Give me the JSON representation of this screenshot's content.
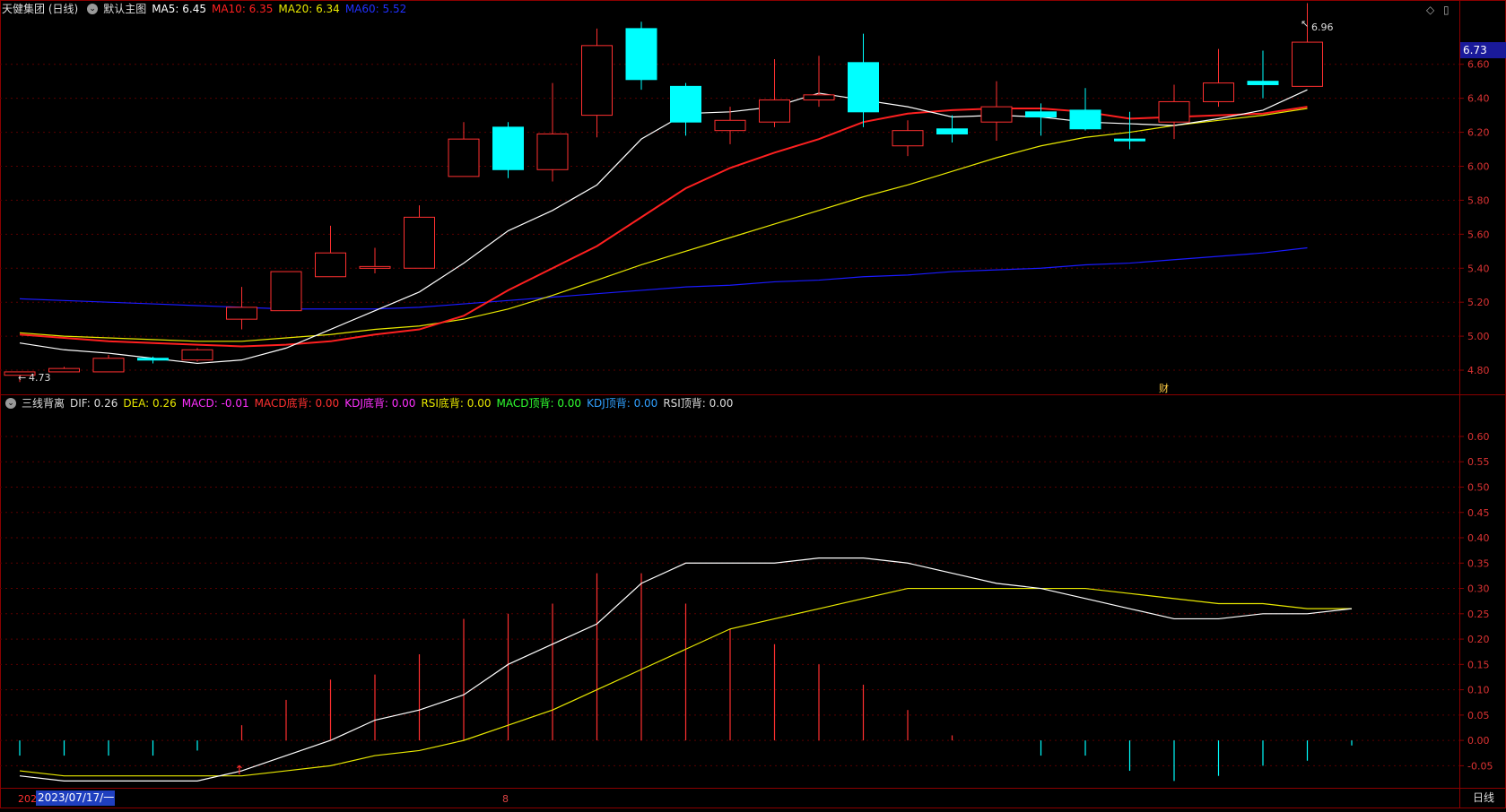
{
  "main_header": {
    "stock_name": "天健集团 (日线)",
    "template": "默认主图",
    "ma5": {
      "label": "MA5: 6.45",
      "color": "#ffffff"
    },
    "ma10": {
      "label": "MA10: 6.35",
      "color": "#ff2020"
    },
    "ma20": {
      "label": "MA20: 6.34",
      "color": "#e8e800"
    },
    "ma60": {
      "label": "MA60: 5.52",
      "color": "#2030ff"
    }
  },
  "sub_header": {
    "indicator": "三线背离",
    "dif": "DIF: 0.26",
    "dea": "DEA: 0.26",
    "macd": "MACD: -0.01",
    "macd_bottom": "MACD底背: 0.00",
    "kdj_bottom": "KDJ底背: 0.00",
    "rsi_bottom": "RSI底背: 0.00",
    "macd_top": "MACD顶背: 0.00",
    "kdj_top": "KDJ顶背: 0.00",
    "rsi_top": "RSI顶背: 0.00"
  },
  "annotations": {
    "low_label": "4.73",
    "high_label": "6.96",
    "current_price": "6.73",
    "finance_marker": "财"
  },
  "footer": {
    "year_prefix": "202",
    "date_cursor": "2023/07/17/一",
    "month_marker": "8",
    "period_button": "日线"
  },
  "price_axis": [
    "6.60",
    "6.40",
    "6.20",
    "6.00",
    "5.80",
    "5.60",
    "5.40",
    "5.20",
    "5.00",
    "4.80"
  ],
  "macd_axis": [
    "0.60",
    "0.55",
    "0.50",
    "0.45",
    "0.40",
    "0.35",
    "0.30",
    "0.25",
    "0.20",
    "0.15",
    "0.10",
    "0.05",
    "0.00",
    "-0.05"
  ],
  "colors": {
    "up": "#ff3030",
    "down": "#00ffff",
    "ma60": "#1a1aff",
    "grid": "#5a0000",
    "axis": "#8b0000"
  },
  "chart_data": {
    "type": "candlestick",
    "candles": [
      {
        "o": 4.77,
        "c": 4.79,
        "h": 4.79,
        "l": 4.73
      },
      {
        "o": 4.79,
        "c": 4.81,
        "h": 4.82,
        "l": 4.79
      },
      {
        "o": 4.79,
        "c": 4.87,
        "h": 4.89,
        "l": 4.79
      },
      {
        "o": 4.87,
        "c": 4.86,
        "h": 4.88,
        "l": 4.84
      },
      {
        "o": 4.86,
        "c": 4.92,
        "h": 4.93,
        "l": 4.85
      },
      {
        "o": 5.1,
        "c": 5.17,
        "h": 5.29,
        "l": 5.04
      },
      {
        "o": 5.15,
        "c": 5.38,
        "h": 5.38,
        "l": 5.15
      },
      {
        "o": 5.35,
        "c": 5.49,
        "h": 5.65,
        "l": 5.35
      },
      {
        "o": 5.4,
        "c": 5.41,
        "h": 5.52,
        "l": 5.37
      },
      {
        "o": 5.4,
        "c": 5.7,
        "h": 5.77,
        "l": 5.4
      },
      {
        "o": 5.94,
        "c": 6.16,
        "h": 6.26,
        "l": 5.94
      },
      {
        "o": 6.23,
        "c": 5.98,
        "h": 6.26,
        "l": 5.93
      },
      {
        "o": 5.98,
        "c": 6.19,
        "h": 6.49,
        "l": 5.91
      },
      {
        "o": 6.3,
        "c": 6.71,
        "h": 6.81,
        "l": 6.17
      },
      {
        "o": 6.81,
        "c": 6.51,
        "h": 6.85,
        "l": 6.45
      },
      {
        "o": 6.47,
        "c": 6.26,
        "h": 6.49,
        "l": 6.18
      },
      {
        "o": 6.21,
        "c": 6.27,
        "h": 6.35,
        "l": 6.13
      },
      {
        "o": 6.26,
        "c": 6.39,
        "h": 6.63,
        "l": 6.23
      },
      {
        "o": 6.39,
        "c": 6.42,
        "h": 6.65,
        "l": 6.35
      },
      {
        "o": 6.61,
        "c": 6.32,
        "h": 6.78,
        "l": 6.23
      },
      {
        "o": 6.12,
        "c": 6.21,
        "h": 6.27,
        "l": 6.06
      },
      {
        "o": 6.22,
        "c": 6.19,
        "h": 6.3,
        "l": 6.14
      },
      {
        "o": 6.26,
        "c": 6.35,
        "h": 6.5,
        "l": 6.15
      },
      {
        "o": 6.32,
        "c": 6.29,
        "h": 6.37,
        "l": 6.18
      },
      {
        "o": 6.33,
        "c": 6.22,
        "h": 6.46,
        "l": 6.21
      },
      {
        "o": 6.16,
        "c": 6.15,
        "h": 6.32,
        "l": 6.1
      },
      {
        "o": 6.26,
        "c": 6.38,
        "h": 6.48,
        "l": 6.16
      },
      {
        "o": 6.38,
        "c": 6.49,
        "h": 6.69,
        "l": 6.35
      },
      {
        "o": 6.5,
        "c": 6.48,
        "h": 6.68,
        "l": 6.4
      },
      {
        "o": 6.47,
        "c": 6.73,
        "h": 6.96,
        "l": 6.47
      }
    ],
    "ma5": [
      4.96,
      4.92,
      4.9,
      4.87,
      4.84,
      4.86,
      4.93,
      5.04,
      5.15,
      5.26,
      5.43,
      5.62,
      5.74,
      5.89,
      6.16,
      6.31,
      6.32,
      6.35,
      6.43,
      6.39,
      6.35,
      6.29,
      6.3,
      6.29,
      6.26,
      6.25,
      6.24,
      6.28,
      6.33,
      6.45
    ],
    "ma10": [
      5.01,
      4.99,
      4.97,
      4.96,
      4.95,
      4.94,
      4.95,
      4.97,
      5.01,
      5.04,
      5.12,
      5.27,
      5.4,
      5.53,
      5.7,
      5.87,
      5.99,
      6.08,
      6.16,
      6.26,
      6.31,
      6.33,
      6.34,
      6.34,
      6.32,
      6.28,
      6.29,
      6.3,
      6.31,
      6.35
    ],
    "ma20": [
      5.02,
      5.0,
      4.99,
      4.98,
      4.97,
      4.97,
      4.99,
      5.01,
      5.04,
      5.06,
      5.1,
      5.16,
      5.24,
      5.33,
      5.42,
      5.5,
      5.58,
      5.66,
      5.74,
      5.82,
      5.89,
      5.97,
      6.05,
      6.12,
      6.17,
      6.2,
      6.24,
      6.27,
      6.3,
      6.34
    ],
    "ma60": [
      5.22,
      5.21,
      5.2,
      5.19,
      5.18,
      5.17,
      5.16,
      5.16,
      5.16,
      5.17,
      5.19,
      5.21,
      5.23,
      5.25,
      5.27,
      5.29,
      5.3,
      5.32,
      5.33,
      5.35,
      5.36,
      5.38,
      5.39,
      5.4,
      5.42,
      5.43,
      5.45,
      5.47,
      5.49,
      5.52
    ],
    "dif": [
      -0.07,
      -0.08,
      -0.08,
      -0.08,
      -0.08,
      -0.06,
      -0.03,
      0.0,
      0.04,
      0.06,
      0.09,
      0.15,
      0.19,
      0.23,
      0.31,
      0.35,
      0.35,
      0.35,
      0.36,
      0.36,
      0.35,
      0.33,
      0.31,
      0.3,
      0.28,
      0.26,
      0.24,
      0.24,
      0.25,
      0.25,
      0.26
    ],
    "dea": [
      -0.06,
      -0.07,
      -0.07,
      -0.07,
      -0.07,
      -0.07,
      -0.06,
      -0.05,
      -0.03,
      -0.02,
      0.0,
      0.03,
      0.06,
      0.1,
      0.14,
      0.18,
      0.22,
      0.24,
      0.26,
      0.28,
      0.3,
      0.3,
      0.3,
      0.3,
      0.3,
      0.29,
      0.28,
      0.27,
      0.27,
      0.26,
      0.26
    ],
    "macd": [
      -0.03,
      -0.03,
      -0.03,
      -0.03,
      -0.02,
      0.03,
      0.08,
      0.12,
      0.13,
      0.17,
      0.24,
      0.25,
      0.27,
      0.33,
      0.33,
      0.27,
      0.22,
      0.19,
      0.15,
      0.11,
      0.06,
      0.01,
      0.0,
      -0.03,
      -0.03,
      -0.06,
      -0.08,
      -0.07,
      -0.05,
      -0.04,
      -0.01
    ],
    "price_ylim": [
      4.7,
      6.82
    ],
    "macd_ylim": [
      -0.09,
      0.63
    ]
  }
}
